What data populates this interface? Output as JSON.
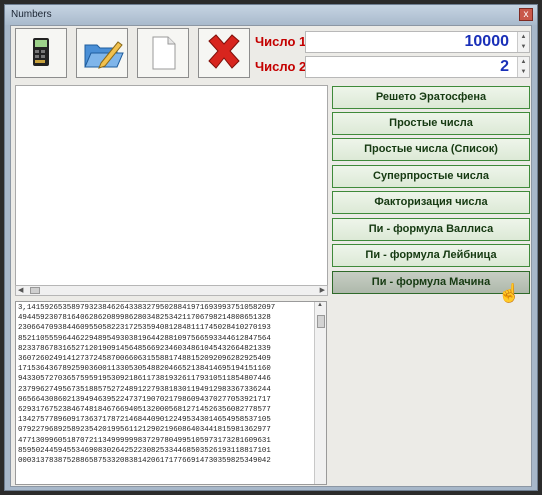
{
  "window": {
    "title": "Numbers",
    "close_glyph": "x"
  },
  "toolbar": [
    {
      "name": "calculator-icon"
    },
    {
      "name": "open-folder-icon"
    },
    {
      "name": "new-document-icon"
    },
    {
      "name": "delete-icon"
    }
  ],
  "inputs": {
    "number1": {
      "label": "Число 1:",
      "value": "10000"
    },
    "number2": {
      "label": "Число 2:",
      "value": "2"
    }
  },
  "buttons": [
    "Решето Эратосфена",
    "Простые числа",
    "Простые числа (Список)",
    "Суперпростые числа",
    "Факторизация числа",
    "Пи - формула Валлиса",
    "Пи - формула Лейбница",
    "Пи - формула Мачина"
  ],
  "output_lines": [
    "3,14159265358979323846264338327950288419716939937510582097",
    "494459230781640628620899862803482534211706798214808651328",
    "230664709384460955058223172535940812848111745028410270193",
    "852110555964462294895493038196442881097566593344612847564",
    "823378678316527120190914564856692346034861045432664821339",
    "360726024914127372458700660631558817488152092096282925409",
    "171536436789259036001133053054882046652138414695194151160",
    "943305727036575959195309218611738193261179310511854807446",
    "237996274956735188575272489122793818301194912983367336244",
    "065664308602139494639522473719070217986094370277053921717",
    "629317675238467481846766940513200056812714526356082778577",
    "134275778960917363717872146844090122495343014654958537105",
    "079227968925892354201995611212902196086403441815981362977",
    "477130996051870721134999999837297804995105973173281609631",
    "859502445945534690830264252230825334468503526193118817101",
    "000313783875288658753320838142061717766914730359825349042"
  ],
  "colors": {
    "label_red": "#c40000",
    "value_blue": "#1a30b8",
    "button_border": "#3f8a3a"
  }
}
